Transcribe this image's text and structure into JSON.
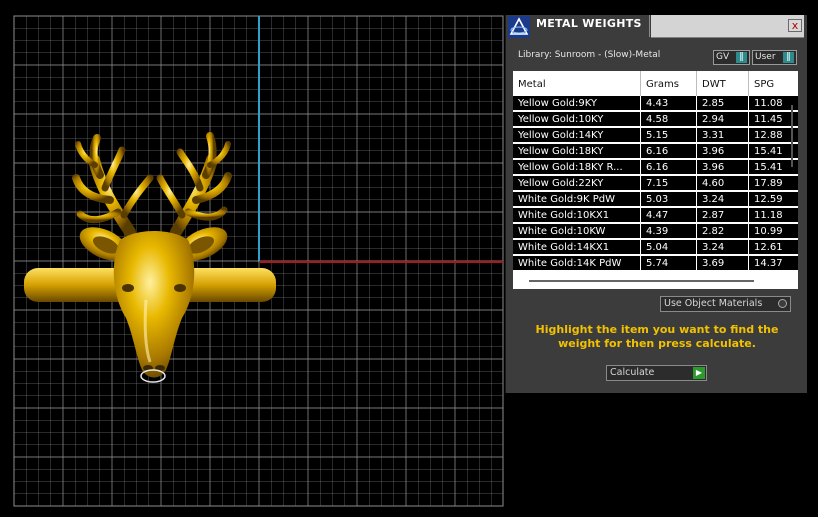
{
  "viewport": {
    "model": "deer-head-ring",
    "colors": {
      "grid": "#8e8e8e",
      "axis_vertical": "#2fa2c8",
      "axis_horizontal": "#b01818",
      "metal": "#d4a400"
    }
  },
  "panel": {
    "title": "METAL WEIGHTS",
    "close_label": "x",
    "library_label": "Library: Sunroom - (Slow)-Metal",
    "selects": {
      "gv": "GV",
      "user": "User"
    },
    "table": {
      "columns": [
        "Metal",
        "Grams",
        "DWT",
        "SPG"
      ],
      "rows": [
        [
          "Yellow Gold:9KY",
          "4.43",
          "2.85",
          "11.08"
        ],
        [
          "Yellow Gold:10KY",
          "4.58",
          "2.94",
          "11.45"
        ],
        [
          "Yellow Gold:14KY",
          "5.15",
          "3.31",
          "12.88"
        ],
        [
          "Yellow Gold:18KY",
          "6.16",
          "3.96",
          "15.41"
        ],
        [
          "Yellow Gold:18KY R...",
          "6.16",
          "3.96",
          "15.41"
        ],
        [
          "Yellow Gold:22KY",
          "7.15",
          "4.60",
          "17.89"
        ],
        [
          "White Gold:9K PdW",
          "5.03",
          "3.24",
          "12.59"
        ],
        [
          "White Gold:10KX1",
          "4.47",
          "2.87",
          "11.18"
        ],
        [
          "White Gold:10KW",
          "4.39",
          "2.82",
          "10.99"
        ],
        [
          "White Gold:14KX1",
          "5.04",
          "3.24",
          "12.61"
        ],
        [
          "White Gold:14K PdW",
          "5.74",
          "3.69",
          "14.37"
        ]
      ]
    },
    "use_object_materials_label": "Use Object Materials",
    "instructions": "Highlight the item you want to find the weight for then press calculate.",
    "calculate_label": "Calculate"
  }
}
